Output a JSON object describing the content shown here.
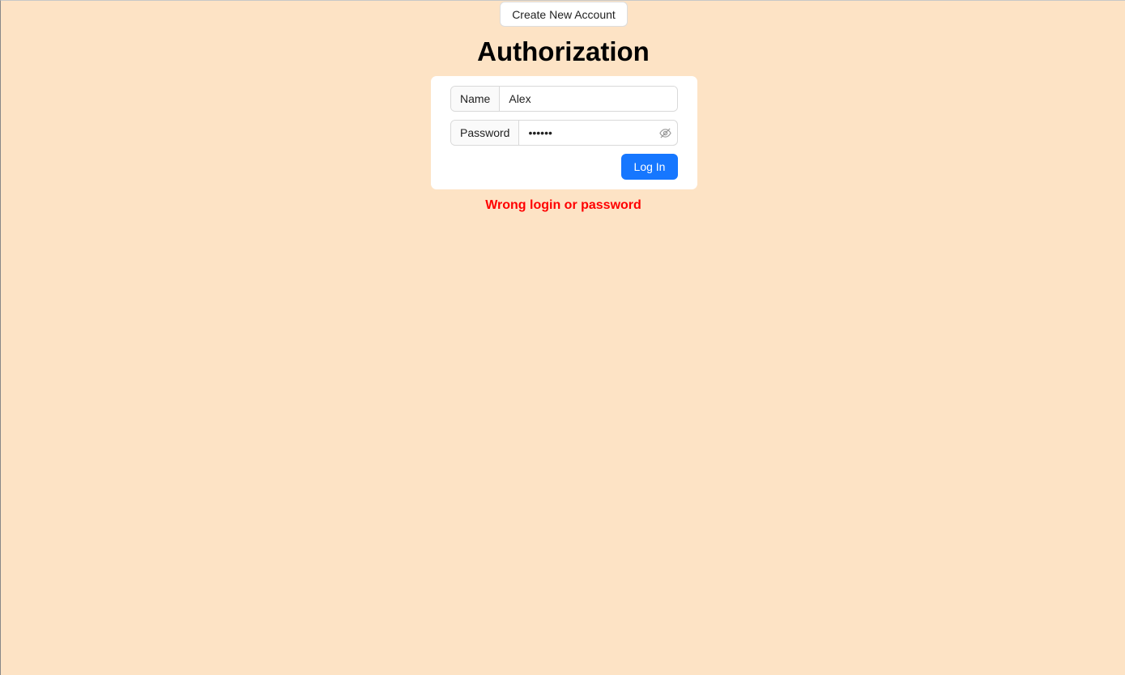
{
  "header": {
    "create_account_label": "Create New Account"
  },
  "page_title": "Authorization",
  "form": {
    "name_label": "Name",
    "name_value": "Alex",
    "password_label": "Password",
    "password_value": "••••••",
    "password_icon": "eye-invisible-icon",
    "login_label": "Log In"
  },
  "error_message": "Wrong login or password",
  "colors": {
    "background": "#fde3c5",
    "primary": "#1677ff",
    "error": "#ff0000"
  }
}
